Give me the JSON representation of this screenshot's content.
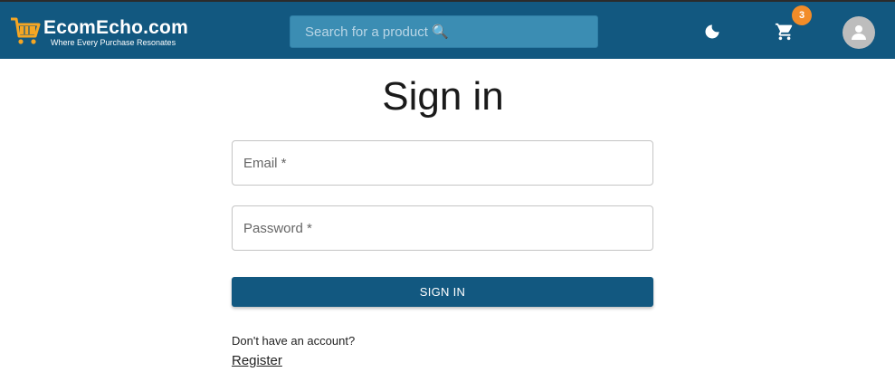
{
  "header": {
    "brand": "EcomEcho.com",
    "tagline": "Where Every Purchase Resonates",
    "search_placeholder": "Search for a product 🔍",
    "cart_count": "3",
    "colors": {
      "bar": "#125880",
      "badge": "#f28c28",
      "logo_cart": "#f5a623"
    },
    "icons": [
      "shopping-cart-logo-icon",
      "moon-icon",
      "cart-icon",
      "account-icon"
    ]
  },
  "form": {
    "title": "Sign in",
    "email_placeholder": "Email *",
    "password_placeholder": "Password *",
    "submit_label": "SIGN IN",
    "no_account_text": "Don't have an account?",
    "register_link": "Register"
  }
}
